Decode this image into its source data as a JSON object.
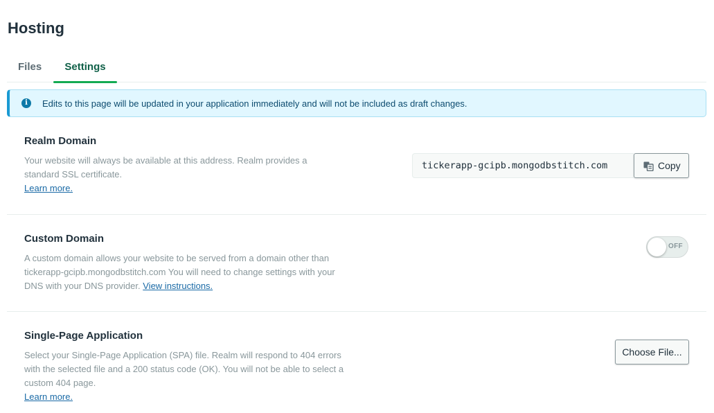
{
  "page": {
    "title": "Hosting"
  },
  "tabs": [
    {
      "label": "Files",
      "active": false
    },
    {
      "label": "Settings",
      "active": true
    }
  ],
  "banner": {
    "icon": "info-icon",
    "message": "Edits to this page will be updated in your application immediately and will not be included as draft changes."
  },
  "realm_domain": {
    "title": "Realm Domain",
    "description": "Your website will always be available at this address. Realm provides a standard SSL certificate.",
    "learn_more": "Learn more.",
    "domain_value": "tickerapp-gcipb.mongodbstitch.com",
    "copy_label": "Copy",
    "copy_icon": "copy-icon"
  },
  "custom_domain": {
    "title": "Custom Domain",
    "description": "A custom domain allows your website to be served from a domain other than tickerapp-gcipb.mongodbstitch.com You will need to change settings with your DNS with your DNS provider.",
    "link": "View instructions.",
    "toggle_label": "OFF",
    "enabled": false
  },
  "spa": {
    "title": "Single-Page Application",
    "description": "Select your Single-Page Application (SPA) file. Realm will respond to 404 errors with the selected file and a 200 status code (OK). You will not be able to select a custom 404 page.",
    "learn_more": "Learn more.",
    "button_label": "Choose File..."
  },
  "colors": {
    "accent": "#13aa52",
    "active_tab_text": "#116149",
    "banner_bg": "#e1f7ff",
    "banner_border": "#1a9ad3",
    "link": "#1a6aa6"
  }
}
